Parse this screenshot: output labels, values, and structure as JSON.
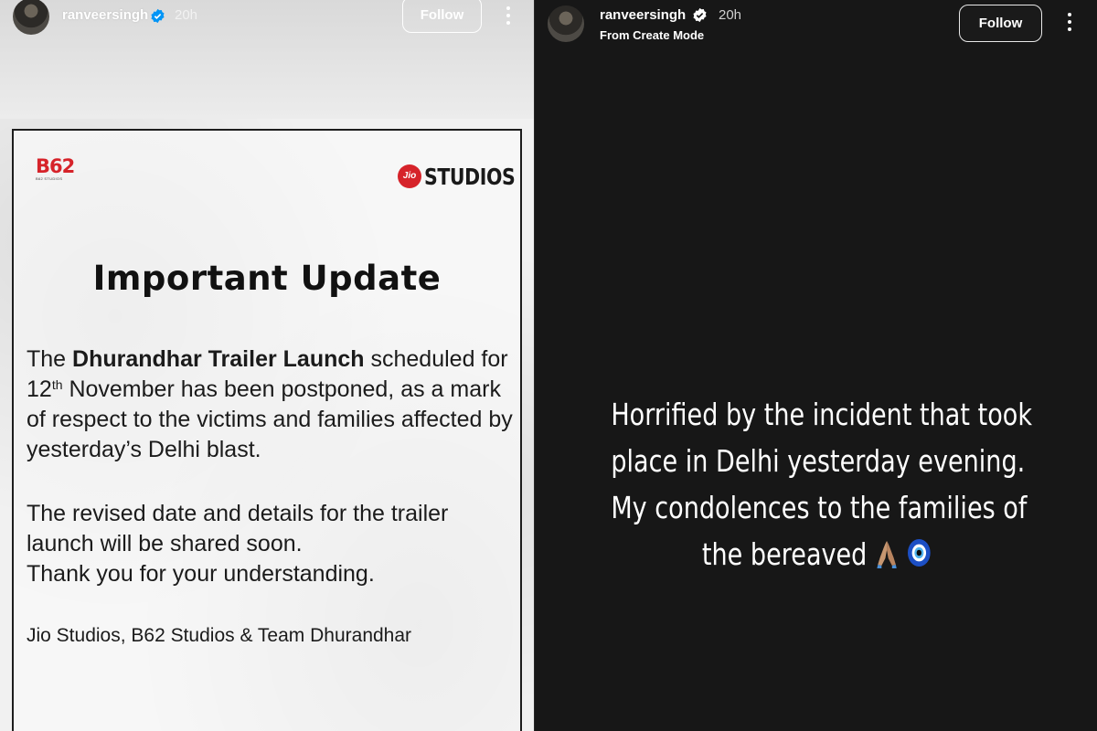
{
  "left_story": {
    "username": "ranveersingh",
    "timestamp": "20h",
    "follow_label": "Follow",
    "poster": {
      "b62_logo": "B62",
      "b62_sub": "B62 STUDIOS",
      "jio_badge": "Jio",
      "jio_word": "STUDIOS",
      "title": "Important Update",
      "para1_pre": "The ",
      "para1_bold": "Dhurandhar Trailer Launch",
      "para1_post1": " scheduled for 12",
      "para1_sup": "th",
      "para1_post2": " November has been postponed, as a mark of respect to the victims and families affected by yesterday’s Delhi blast.",
      "para2": "The revised date and details for the trailer launch will be shared soon.",
      "para2b": "Thank you for your understanding.",
      "sign": "Jio Studios, B62 Studios & Team Dhurandhar"
    }
  },
  "right_story": {
    "username": "ranveersingh",
    "timestamp": "20h",
    "subtitle": "From Create Mode",
    "follow_label": "Follow",
    "message_lines": [
      "Horrified by the incident that took",
      "place in Delhi yesterday evening.",
      "My condolences to the families of",
      "the bereaved"
    ],
    "emojis": [
      "folded-hands-emoji",
      "nazar-amulet-emoji"
    ]
  },
  "colors": {
    "brand_red": "#d6232a",
    "verified_blue": "#0095f6",
    "dark_bg": "#171717"
  }
}
